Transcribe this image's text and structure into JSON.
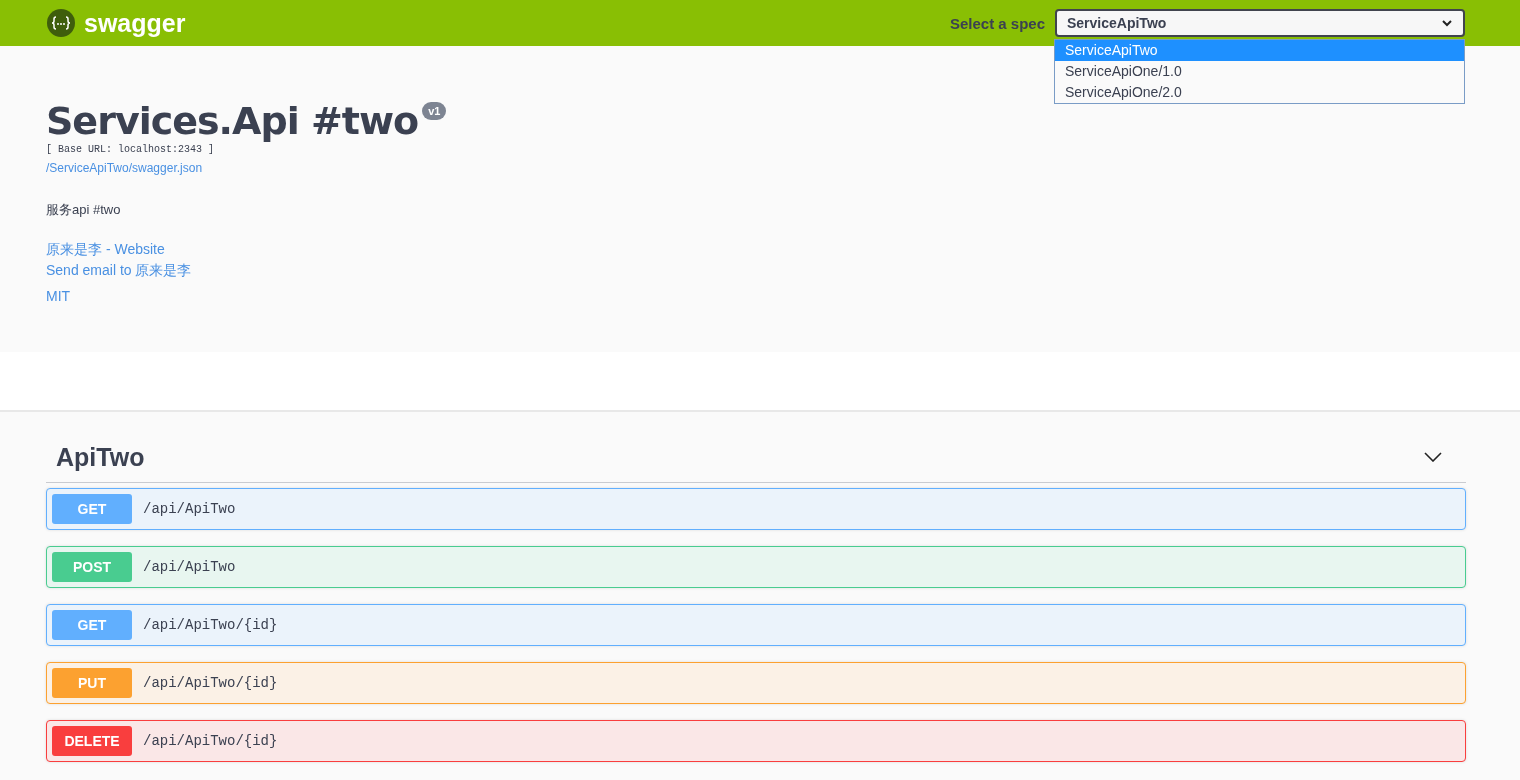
{
  "topbar": {
    "logo_text": "swagger",
    "spec_label": "Select a spec",
    "spec_value": "ServiceApiTwo",
    "spec_options": [
      {
        "label": "ServiceApiTwo",
        "selected": true
      },
      {
        "label": "ServiceApiOne/1.0",
        "selected": false
      },
      {
        "label": "ServiceApiOne/2.0",
        "selected": false
      }
    ]
  },
  "info": {
    "title": "Services.Api #two",
    "version": "v1",
    "base_url": "[ Base URL: localhost:2343 ]",
    "spec_link": "/ServiceApiTwo/swagger.json",
    "description": "服务api #two",
    "links": [
      "原来是李 - Website",
      "Send email to 原来是李",
      "MIT"
    ]
  },
  "tag": {
    "name": "ApiTwo",
    "expanded": true,
    "operations": [
      {
        "kind": "get",
        "method": "GET",
        "path": "/api/ApiTwo"
      },
      {
        "kind": "post",
        "method": "POST",
        "path": "/api/ApiTwo"
      },
      {
        "kind": "get",
        "method": "GET",
        "path": "/api/ApiTwo/{id}"
      },
      {
        "kind": "put",
        "method": "PUT",
        "path": "/api/ApiTwo/{id}"
      },
      {
        "kind": "delete",
        "method": "DELETE",
        "path": "/api/ApiTwo/{id}"
      }
    ]
  }
}
